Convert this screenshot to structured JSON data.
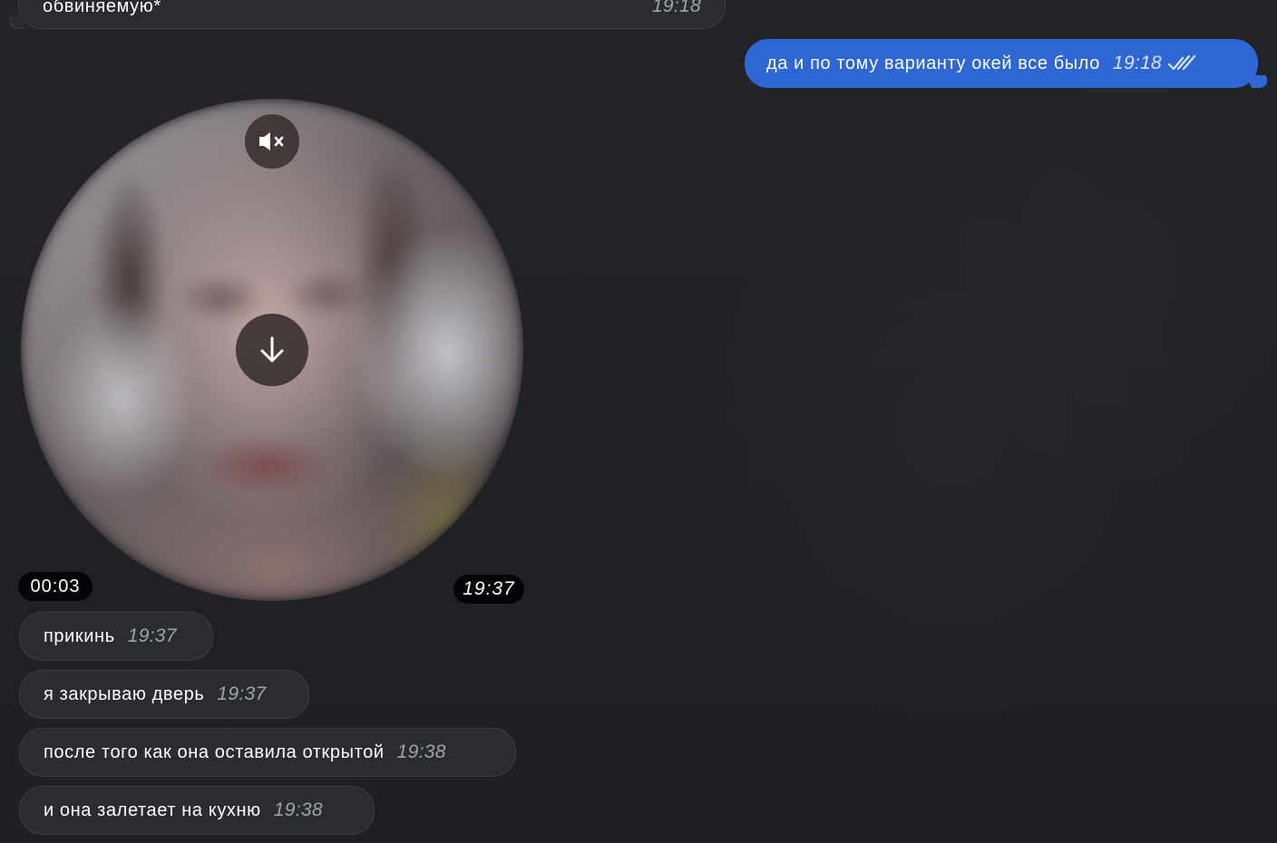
{
  "colors": {
    "background": "#202226",
    "incoming_bubble": "#2a2c30",
    "outgoing_bubble": "#2e66d4",
    "timestamp": "#a0a4aa"
  },
  "top_message": {
    "text": "обвиняемую*",
    "time": "19:18"
  },
  "outgoing_message": {
    "text": "да и по тому варианту окей все было",
    "time": "19:18",
    "status_icon": "double-check-read"
  },
  "video_message": {
    "mute_icon": "speaker-muted",
    "download_icon": "arrow-down",
    "duration": "00:03",
    "time": "19:37"
  },
  "messages": [
    {
      "text": "прикинь",
      "time": "19:37"
    },
    {
      "text": "я закрываю дверь",
      "time": "19:37"
    },
    {
      "text": "после того как она оставила открытой",
      "time": "19:38"
    },
    {
      "text": "и она залетает на кухню",
      "time": "19:38"
    }
  ]
}
